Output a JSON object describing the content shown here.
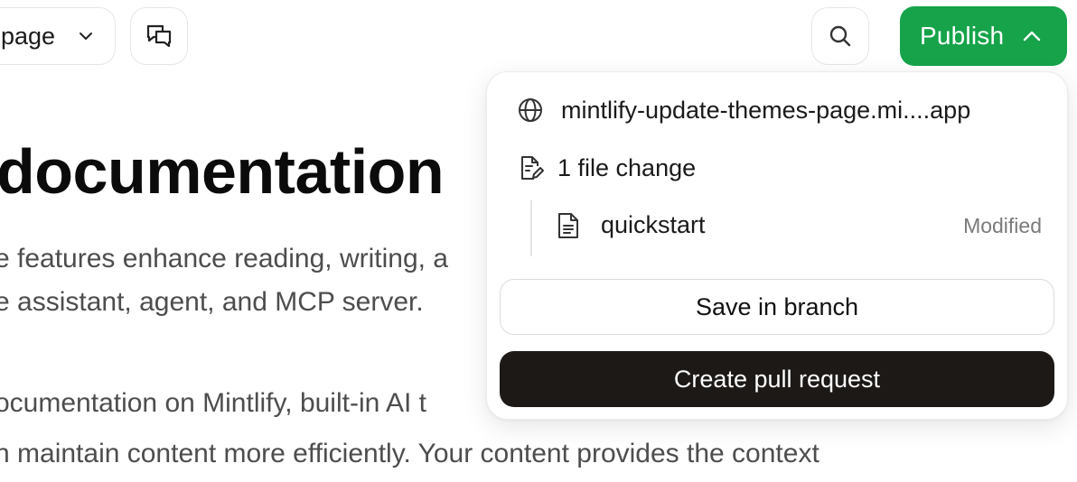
{
  "toolbar": {
    "page_selector_label": "page",
    "publish_label": "Publish"
  },
  "doc": {
    "title": "documentation",
    "intro_line_1": "e features enhance reading, writing, a",
    "intro_line_2": "e assistant, agent, and MCP server.",
    "body_line_1": "ocumentation on Mintlify, built-in AI t",
    "body_line_2": "n maintain content more efficiently. Your content provides the context"
  },
  "publish_menu": {
    "preview_url": "mintlify-update-themes-page.mi....app",
    "changes_summary": "1 file change",
    "files": [
      {
        "name": "quickstart",
        "status": "Modified"
      }
    ],
    "save_label": "Save in branch",
    "pr_label": "Create pull request"
  },
  "colors": {
    "publish_green": "#16a34a",
    "primary_dark": "#1c1917"
  },
  "icons": [
    "chevron-down-icon",
    "comments-icon",
    "search-icon",
    "chevron-up-icon",
    "globe-icon",
    "file-edit-icon",
    "file-icon"
  ]
}
